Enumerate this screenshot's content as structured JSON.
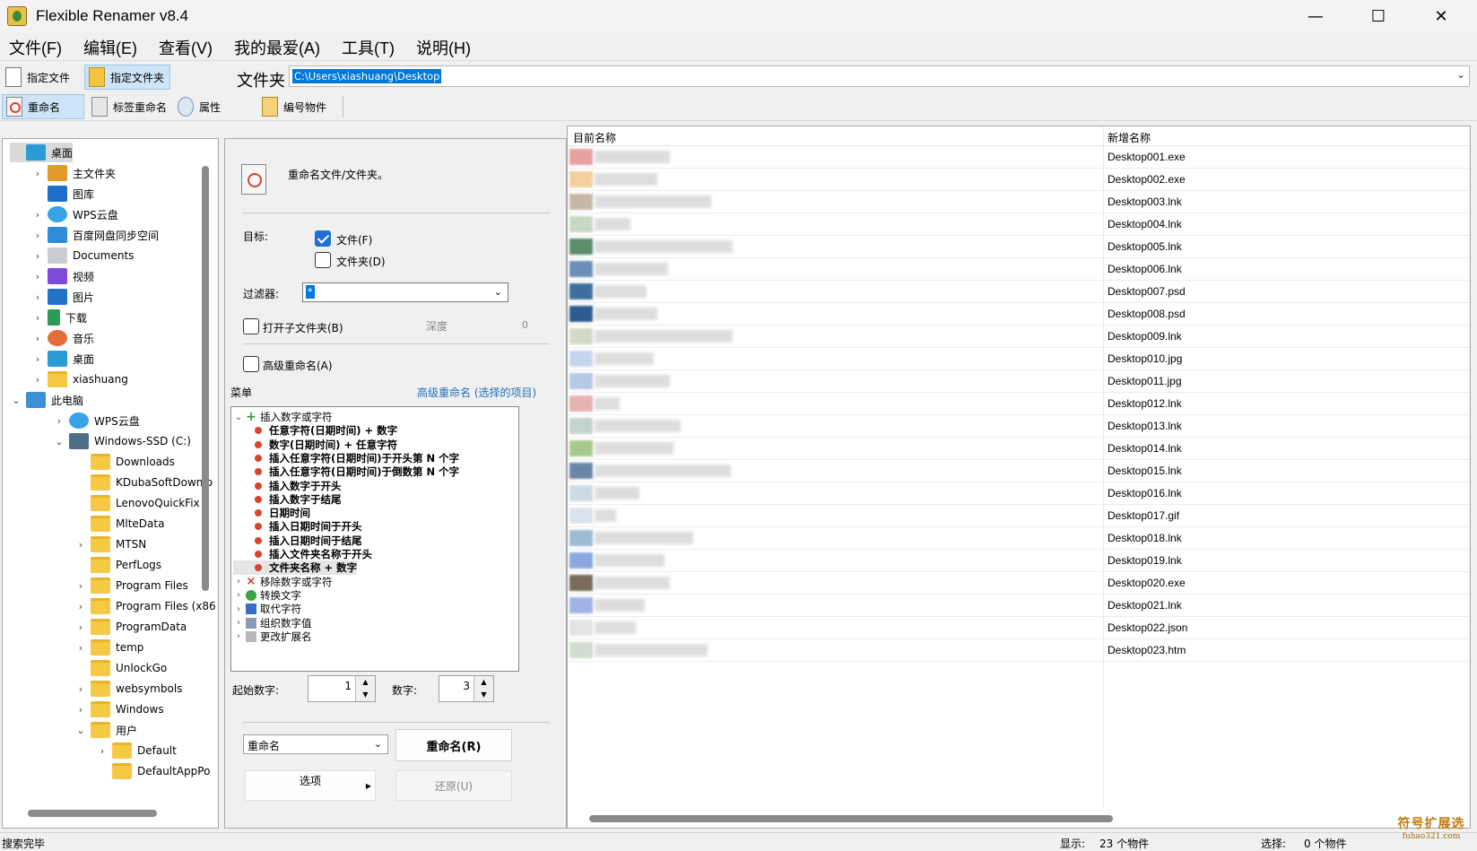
{
  "window": {
    "title": "Flexible Renamer v8.4",
    "min": "—",
    "max": "☐",
    "close": "✕"
  },
  "menubar": [
    "文件(F)",
    "编辑(E)",
    "查看(V)",
    "我的最爱(A)",
    "工具(T)",
    "说明(H)"
  ],
  "toolbar1": {
    "files": "指定文件",
    "folders": "指定文件夹",
    "path_label": "文件夹",
    "path_value": "C:\\Users\\xiashuang\\Desktop"
  },
  "toolbar2": {
    "rename": "重命名",
    "tag_rename": "标签重命名",
    "attributes": "属性",
    "number_items": "编号物件"
  },
  "tree": {
    "items": [
      {
        "label": "桌面",
        "icon": "desktop-icon",
        "exp": "",
        "cls": "ti-desktop",
        "selected": true
      },
      {
        "label": "主文件夹",
        "icon": "home-icon",
        "exp": "›",
        "cls": "ti-home"
      },
      {
        "label": "图库",
        "icon": "gallery-icon",
        "exp": "",
        "cls": "ti-gallery"
      },
      {
        "label": "WPS云盘",
        "icon": "cloud-icon",
        "exp": "›",
        "cls": "ti-cloud"
      },
      {
        "label": "百度网盘同步空间",
        "icon": "sync-icon",
        "exp": "›",
        "cls": "ti-sync"
      },
      {
        "label": "Documents",
        "icon": "documents-icon",
        "exp": "›",
        "cls": "ti-docs"
      },
      {
        "label": "视频",
        "icon": "video-icon",
        "exp": "›",
        "cls": "ti-video"
      },
      {
        "label": "图片",
        "icon": "pictures-icon",
        "exp": "›",
        "cls": "ti-pics"
      },
      {
        "label": "下载",
        "icon": "download-icon",
        "exp": "›",
        "cls": "ti-down"
      },
      {
        "label": "音乐",
        "icon": "music-icon",
        "exp": "›",
        "cls": "ti-music"
      },
      {
        "label": "桌面",
        "icon": "desktop-icon",
        "exp": "›",
        "cls": "ti-desktop"
      },
      {
        "label": "xiashuang",
        "icon": "folder-icon",
        "exp": "›",
        "cls": "ti-folder"
      },
      {
        "label": "此电脑",
        "icon": "computer-icon",
        "exp": "⌄",
        "cls": "ti-pc"
      },
      {
        "label": "WPS云盘",
        "icon": "cloud-icon",
        "exp": "›",
        "cls": "ti-cloud"
      },
      {
        "label": "Windows-SSD (C:)",
        "icon": "drive-icon",
        "exp": "⌄",
        "cls": "ti-drive"
      },
      {
        "label": "Downloads",
        "icon": "folder-icon",
        "exp": "",
        "cls": "ti-folder"
      },
      {
        "label": "KDubaSoftDownlo",
        "icon": "folder-icon",
        "exp": "",
        "cls": "ti-folder"
      },
      {
        "label": "LenovoQuickFix",
        "icon": "folder-icon",
        "exp": "",
        "cls": "ti-folder"
      },
      {
        "label": "MlteData",
        "icon": "folder-icon",
        "exp": "",
        "cls": "ti-folder"
      },
      {
        "label": "MTSN",
        "icon": "folder-icon",
        "exp": "›",
        "cls": "ti-folder"
      },
      {
        "label": "PerfLogs",
        "icon": "folder-icon",
        "exp": "",
        "cls": "ti-folder"
      },
      {
        "label": "Program Files",
        "icon": "folder-icon",
        "exp": "›",
        "cls": "ti-folder"
      },
      {
        "label": "Program Files (x86",
        "icon": "folder-icon",
        "exp": "›",
        "cls": "ti-folder"
      },
      {
        "label": "ProgramData",
        "icon": "folder-icon",
        "exp": "›",
        "cls": "ti-folder"
      },
      {
        "label": "temp",
        "icon": "folder-icon",
        "exp": "›",
        "cls": "ti-folder"
      },
      {
        "label": "UnlockGo",
        "icon": "folder-icon",
        "exp": "",
        "cls": "ti-folder"
      },
      {
        "label": "websymbols",
        "icon": "folder-icon",
        "exp": "›",
        "cls": "ti-folder"
      },
      {
        "label": "Windows",
        "icon": "folder-icon",
        "exp": "›",
        "cls": "ti-folder"
      },
      {
        "label": "用户",
        "icon": "folder-icon",
        "exp": "⌄",
        "cls": "ti-folder"
      },
      {
        "label": "Default",
        "icon": "folder-icon",
        "exp": "›",
        "cls": "ti-folder"
      },
      {
        "label": "DefaultAppPo",
        "icon": "folder-icon",
        "exp": "",
        "cls": "ti-folder"
      }
    ]
  },
  "middle": {
    "description": "重命名文件/文件夹。",
    "target_label": "目标:",
    "target_files": "文件(F)",
    "target_folders": "文件夹(D)",
    "filter_label": "过滤器:",
    "filter_value": "*",
    "open_subfolders": "打开子文件夹(B)",
    "depth_label": "深度",
    "depth_value": "0",
    "advanced_rename": "高级重命名(A)",
    "menu_label": "菜单",
    "advanced_link": "高级重命名 (选择的项目)",
    "menu_tree": [
      {
        "label": "插入数字或字符",
        "level": 0,
        "exp": "⌄",
        "icon": "plus-icon",
        "icls": "mt-plus"
      },
      {
        "label": "任意字符(日期时间) + 数字",
        "level": 1
      },
      {
        "label": "数字(日期时间) + 任意字符",
        "level": 1
      },
      {
        "label": "插入任意字符(日期时间)于开头第 N 个字",
        "level": 1
      },
      {
        "label": "插入任意字符(日期时间)于倒数第 N 个字",
        "level": 1
      },
      {
        "label": "插入数字于开头",
        "level": 1
      },
      {
        "label": "插入数字于结尾",
        "level": 1
      },
      {
        "label": "日期时间",
        "level": 1
      },
      {
        "label": "插入日期时间于开头",
        "level": 1
      },
      {
        "label": "插入日期时间于结尾",
        "level": 1
      },
      {
        "label": "插入文件夹名称于开头",
        "level": 1
      },
      {
        "label": "文件夹名称 + 数字",
        "level": 1,
        "selected": true
      },
      {
        "label": "移除数字或字符",
        "level": 0,
        "exp": "›",
        "icon": "remove-icon",
        "icls": "mt-x"
      },
      {
        "label": "转换文字",
        "level": 0,
        "exp": "›",
        "icon": "convert-icon",
        "icls": "mt-gear"
      },
      {
        "label": "取代字符",
        "level": 0,
        "exp": "›",
        "icon": "replace-icon",
        "icls": "mt-arrow"
      },
      {
        "label": "组织数字值",
        "level": 0,
        "exp": "›",
        "icon": "organize-icon",
        "icls": "mt-grid"
      },
      {
        "label": "更改扩展名",
        "level": 0,
        "exp": "›",
        "icon": "extension-icon",
        "icls": "mt-ext"
      }
    ],
    "start_label": "起始数字:",
    "start_value": "1",
    "digits_label": "数字:",
    "digits_value": "3",
    "mode_value": "重命名",
    "rename_button": "重命名(R)",
    "options_button": "选项",
    "restore_button": "还原(U)"
  },
  "list": {
    "col_original": "目前名称",
    "col_new": "新增名称",
    "rows": [
      {
        "new": "Desktop001.exe",
        "w": 84,
        "thumb": "#e6a2a2"
      },
      {
        "new": "Desktop002.exe",
        "w": 70,
        "thumb": "#f3cf9c"
      },
      {
        "new": "Desktop003.lnk",
        "w": 130,
        "thumb": "#c9b7a6"
      },
      {
        "new": "Desktop004.lnk",
        "w": 40,
        "thumb": "#c8d8c2"
      },
      {
        "new": "Desktop005.lnk",
        "w": 154,
        "thumb": "#5d8d6b"
      },
      {
        "new": "Desktop006.lnk",
        "w": 82,
        "thumb": "#6c8fb8"
      },
      {
        "new": "Desktop007.psd",
        "w": 58,
        "thumb": "#3f6d9e"
      },
      {
        "new": "Desktop008.psd",
        "w": 70,
        "thumb": "#2f5c8e"
      },
      {
        "new": "Desktop009.lnk",
        "w": 154,
        "thumb": "#d3dbc8"
      },
      {
        "new": "Desktop010.jpg",
        "w": 66,
        "thumb": "#c6d5ee"
      },
      {
        "new": "Desktop011.jpg",
        "w": 84,
        "thumb": "#b7c8e4"
      },
      {
        "new": "Desktop012.lnk",
        "w": 28,
        "thumb": "#e7b2b2"
      },
      {
        "new": "Desktop013.lnk",
        "w": 96,
        "thumb": "#c3d4cc"
      },
      {
        "new": "Desktop014.lnk",
        "w": 88,
        "thumb": "#a7c98f"
      },
      {
        "new": "Desktop015.lnk",
        "w": 152,
        "thumb": "#6b87a8"
      },
      {
        "new": "Desktop016.lnk",
        "w": 50,
        "thumb": "#cfd9e6"
      },
      {
        "new": "Desktop017.gif",
        "w": 24,
        "thumb": "#dde3ec"
      },
      {
        "new": "Desktop018.lnk",
        "w": 110,
        "thumb": "#9dbbd4"
      },
      {
        "new": "Desktop019.lnk",
        "w": 78,
        "thumb": "#8ba7e0"
      },
      {
        "new": "Desktop020.exe",
        "w": 84,
        "thumb": "#7a6a58"
      },
      {
        "new": "Desktop021.lnk",
        "w": 56,
        "thumb": "#9fb3e6"
      },
      {
        "new": "Desktop022.json",
        "w": 46,
        "thumb": "#e4e4e4"
      },
      {
        "new": "Desktop023.htm",
        "w": 126,
        "thumb": "#d2dccf"
      }
    ]
  },
  "status": {
    "text": "搜索完毕",
    "display_label": "显示:",
    "display_count": "23 个物件",
    "select_label": "选择:",
    "select_count": "0 个物件"
  },
  "watermark": {
    "main": "符号扩展选",
    "sub": "fuhao321.com"
  }
}
